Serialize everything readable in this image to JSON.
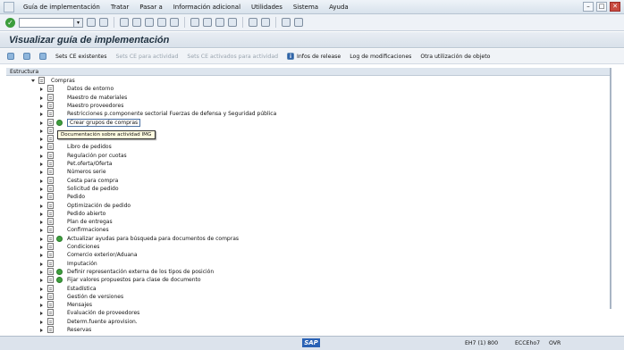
{
  "menubar": {
    "items": [
      "Guía de implementación",
      "Tratar",
      "Pasar a",
      "Información adicional",
      "Utilidades",
      "Sistema",
      "Ayuda"
    ]
  },
  "title": "Visualizar guía de implementación",
  "apptoolbar": {
    "buttons": [
      {
        "label": "Sets CE existentes",
        "enabled": true
      },
      {
        "label": "Sets CE para actividad",
        "enabled": false
      },
      {
        "label": "Sets CE activados para actividad",
        "enabled": false
      },
      {
        "label": "Infos de release",
        "enabled": true
      },
      {
        "label": "Log de modificaciones",
        "enabled": true
      },
      {
        "label": "Otra utilización de objeto",
        "enabled": true
      }
    ]
  },
  "structure_header": "Estructura",
  "tree": [
    {
      "label": "Compras",
      "level": 0,
      "expanded": true,
      "exec": false
    },
    {
      "label": "Datos de entorno",
      "level": 1,
      "expanded": false,
      "exec": false
    },
    {
      "label": "Maestro de materiales",
      "level": 1,
      "expanded": false,
      "exec": false
    },
    {
      "label": "Maestro proveedores",
      "level": 1,
      "expanded": false,
      "exec": false
    },
    {
      "label": "Restricciones p.componente sectorial Fuerzas de defensa y Seguridad pública",
      "level": 1,
      "expanded": false,
      "exec": false
    },
    {
      "label": "Crear grupos de compras",
      "level": 1,
      "expanded": false,
      "exec": true,
      "selected": true
    },
    {
      "label": "",
      "level": 1,
      "expanded": false,
      "exec": false
    },
    {
      "label": "",
      "level": 1,
      "expanded": false,
      "exec": false
    },
    {
      "label": "Libro de pedidos",
      "level": 1,
      "expanded": false,
      "exec": false
    },
    {
      "label": "Regulación por cuotas",
      "level": 1,
      "expanded": false,
      "exec": false
    },
    {
      "label": "Pet.oferta/Oferta",
      "level": 1,
      "expanded": false,
      "exec": false
    },
    {
      "label": "Números serie",
      "level": 1,
      "expanded": false,
      "exec": false
    },
    {
      "label": "Cesta para compra",
      "level": 1,
      "expanded": false,
      "exec": false
    },
    {
      "label": "Solicitud de pedido",
      "level": 1,
      "expanded": false,
      "exec": false
    },
    {
      "label": "Pedido",
      "level": 1,
      "expanded": false,
      "exec": false
    },
    {
      "label": "Optimización de pedido",
      "level": 1,
      "expanded": false,
      "exec": false
    },
    {
      "label": "Pedido abierto",
      "level": 1,
      "expanded": false,
      "exec": false
    },
    {
      "label": "Plan de entregas",
      "level": 1,
      "expanded": false,
      "exec": false
    },
    {
      "label": "Confirmaciones",
      "level": 1,
      "expanded": false,
      "exec": false
    },
    {
      "label": "Actualizar ayudas para búsqueda para documentos de compras",
      "level": 1,
      "expanded": false,
      "exec": true
    },
    {
      "label": "Condiciones",
      "level": 1,
      "expanded": false,
      "exec": false
    },
    {
      "label": "Comercio exterior/Aduana",
      "level": 1,
      "expanded": false,
      "exec": false
    },
    {
      "label": "Imputación",
      "level": 1,
      "expanded": false,
      "exec": false
    },
    {
      "label": "Definir representación externa de los tipos de posición",
      "level": 1,
      "expanded": false,
      "exec": true
    },
    {
      "label": "Fijar valores propuestos para clase de documento",
      "level": 1,
      "expanded": false,
      "exec": true
    },
    {
      "label": "Estadística",
      "level": 1,
      "expanded": false,
      "exec": false
    },
    {
      "label": "Gestión de versiones",
      "level": 1,
      "expanded": false,
      "exec": false
    },
    {
      "label": "Mensajes",
      "level": 1,
      "expanded": false,
      "exec": false
    },
    {
      "label": "Evaluación de proveedores",
      "level": 1,
      "expanded": false,
      "exec": false
    },
    {
      "label": "Determ.fuente aprovision.",
      "level": 1,
      "expanded": false,
      "exec": false
    },
    {
      "label": "Reservas",
      "level": 1,
      "expanded": false,
      "exec": false
    }
  ],
  "tooltip": "Documentación sobre actividad IMG",
  "status": {
    "sap_logo": "SAP",
    "session": "EH7 (1) 800",
    "server": "ECCEho7",
    "mode": "OVR"
  }
}
